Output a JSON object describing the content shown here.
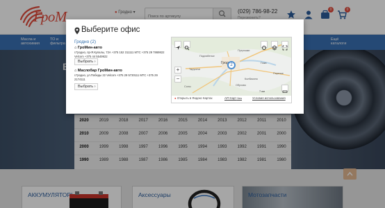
{
  "header": {
    "logo_text": "ГроМ",
    "city": "Гродно",
    "search_placeholder": "Поиск по артикулу",
    "phone": "(029) 786-98-22",
    "callback": "Перезвонить?",
    "cart_count": "0",
    "compare_count": "0"
  },
  "nav": {
    "items": [
      "Масла и автохимия",
      "ТО и фильтра",
      "Ещё каталоги"
    ]
  },
  "hero": {
    "letter": "B"
  },
  "years": {
    "rows": [
      [
        "2020",
        "2019",
        "2018",
        "2017",
        "2016",
        "2015",
        "2014",
        "2013",
        "2012",
        "2011",
        "2010"
      ],
      [
        "2010",
        "2009",
        "2008",
        "2007",
        "2006",
        "2005",
        "2004",
        "2003",
        "2002",
        "2001",
        "2000"
      ],
      [
        "2000",
        "1999",
        "1998",
        "1997",
        "1996",
        "1995",
        "1994",
        "1993",
        "1992",
        "1991",
        "1990"
      ],
      [
        "1990",
        "1989",
        "1988",
        "1987",
        "1986",
        "1985",
        "1984",
        "1983",
        "1982",
        "1981",
        "1980"
      ]
    ]
  },
  "cards": {
    "batteries": "АККУМУЛЯТОРЫ",
    "accessories": "Аксессуары",
    "parts": "Мотозапчасти"
  },
  "modal": {
    "title": "Выберите офис",
    "city_heading": "Гродно (2)",
    "offices": [
      {
        "name": "ГроМин-авто",
        "address": "г.Гродно, пр-Я.Купалы, 72А +375 152 311111 МТС +375 29 7869822 Velcom +375 44 5549922",
        "button": "Выбрать"
      },
      {
        "name": "Маслобар ГроМин-авто",
        "address": "г.Гродно, ул.Победы 22 Velcom +375 29 5730111 МТС +375 29 2174111",
        "button": "Выбрать"
      }
    ],
    "map": {
      "open_link": "Открыть в Яндекс Картах",
      "api_link": "API Карт",
      "api_suffix": "Beta",
      "terms": "Условия использования",
      "scale": "7 км",
      "cluster_count": "2",
      "labels": [
        "Гродно",
        "Подлабенье",
        "Путришки",
        "Гожа",
        "Тарусичи",
        "Колбасино",
        "Обухово",
        "Поречье",
        "Солы"
      ]
    }
  },
  "colors": {
    "accent_red": "#e24b3b",
    "nav_blue": "#3a70b4",
    "link_blue": "#2b6aa8"
  }
}
